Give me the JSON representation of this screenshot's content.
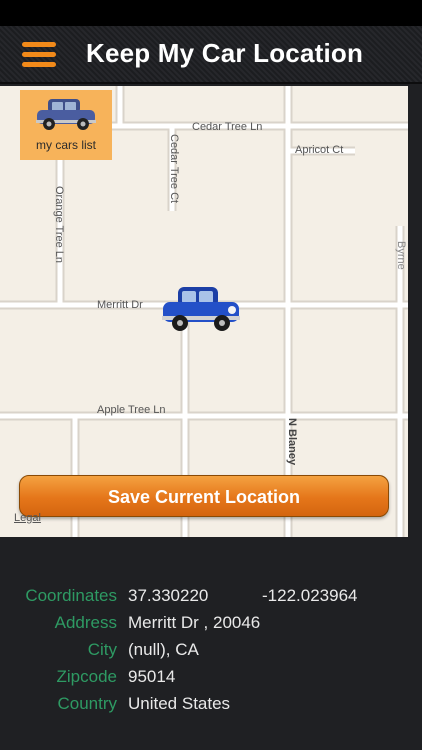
{
  "header": {
    "title": "Keep My Car Location",
    "menu_icon": "hamburger-menu-icon",
    "accent_color": "#f28a1a"
  },
  "map": {
    "streets": {
      "cedar_tree_ln": "Cedar Tree Ln",
      "cedar_tree_ct": "Cedar Tree Ct",
      "apricot_ct": "Apricot Ct",
      "orange_tree_ln": "Orange Tree Ln",
      "merritt_dr": "Merritt Dr",
      "apple_tree_ln": "Apple Tree Ln",
      "n_blaney": "N Blaney",
      "partial_right": "Byrne"
    },
    "cars_list_button": {
      "label": "my cars list",
      "icon": "car-icon"
    },
    "car_marker_icon": "car-icon",
    "legal_label": "Legal"
  },
  "actions": {
    "save_label": "Save Current Location"
  },
  "info": {
    "coordinates_label": "Coordinates",
    "latitude": "37.330220",
    "longitude": "-122.023964",
    "address_label": "Address",
    "address": "Merritt Dr , 20046",
    "city_label": "City",
    "city": "(null), CA",
    "zipcode_label": "Zipcode",
    "zipcode": "95014",
    "country_label": "Country",
    "country": "United States"
  }
}
